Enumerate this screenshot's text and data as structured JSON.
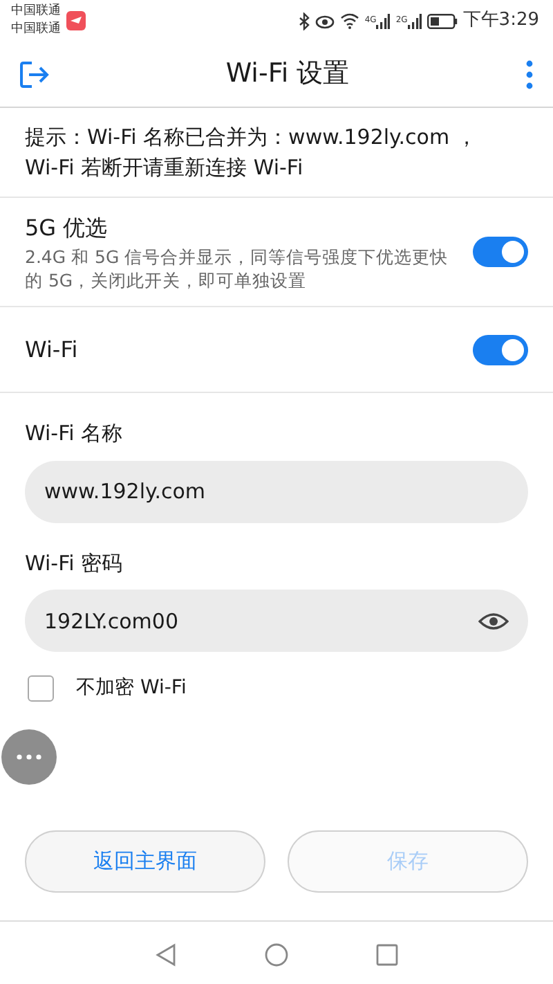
{
  "status_bar": {
    "carriers": [
      "中国联通",
      "中国联通"
    ],
    "time": "下午3:29",
    "network_labels": [
      "4G",
      "2G"
    ]
  },
  "header": {
    "title": "Wi-Fi 设置"
  },
  "hint": "提示：Wi-Fi 名称已合并为：www.192ly.com ，Wi-Fi 若断开请重新连接 Wi-Fi",
  "settings": [
    {
      "label": "5G 优选",
      "description": "2.4G 和 5G 信号合并显示，同等信号强度下优选更快的 5G，关闭此开关，即可单独设置",
      "on": true
    },
    {
      "label": "Wi-Fi",
      "on": true
    }
  ],
  "fields": [
    {
      "label": "Wi-Fi 名称",
      "value": "www.192ly.com",
      "kind": "text"
    },
    {
      "label": "Wi-Fi 密码",
      "value": "192LY.com00",
      "kind": "password"
    }
  ],
  "no_encryption": {
    "label": "不加密 Wi-Fi",
    "checked": false
  },
  "buttons": [
    {
      "label": "返回主界面",
      "disabled": false
    },
    {
      "label": "保存",
      "disabled": true
    }
  ]
}
